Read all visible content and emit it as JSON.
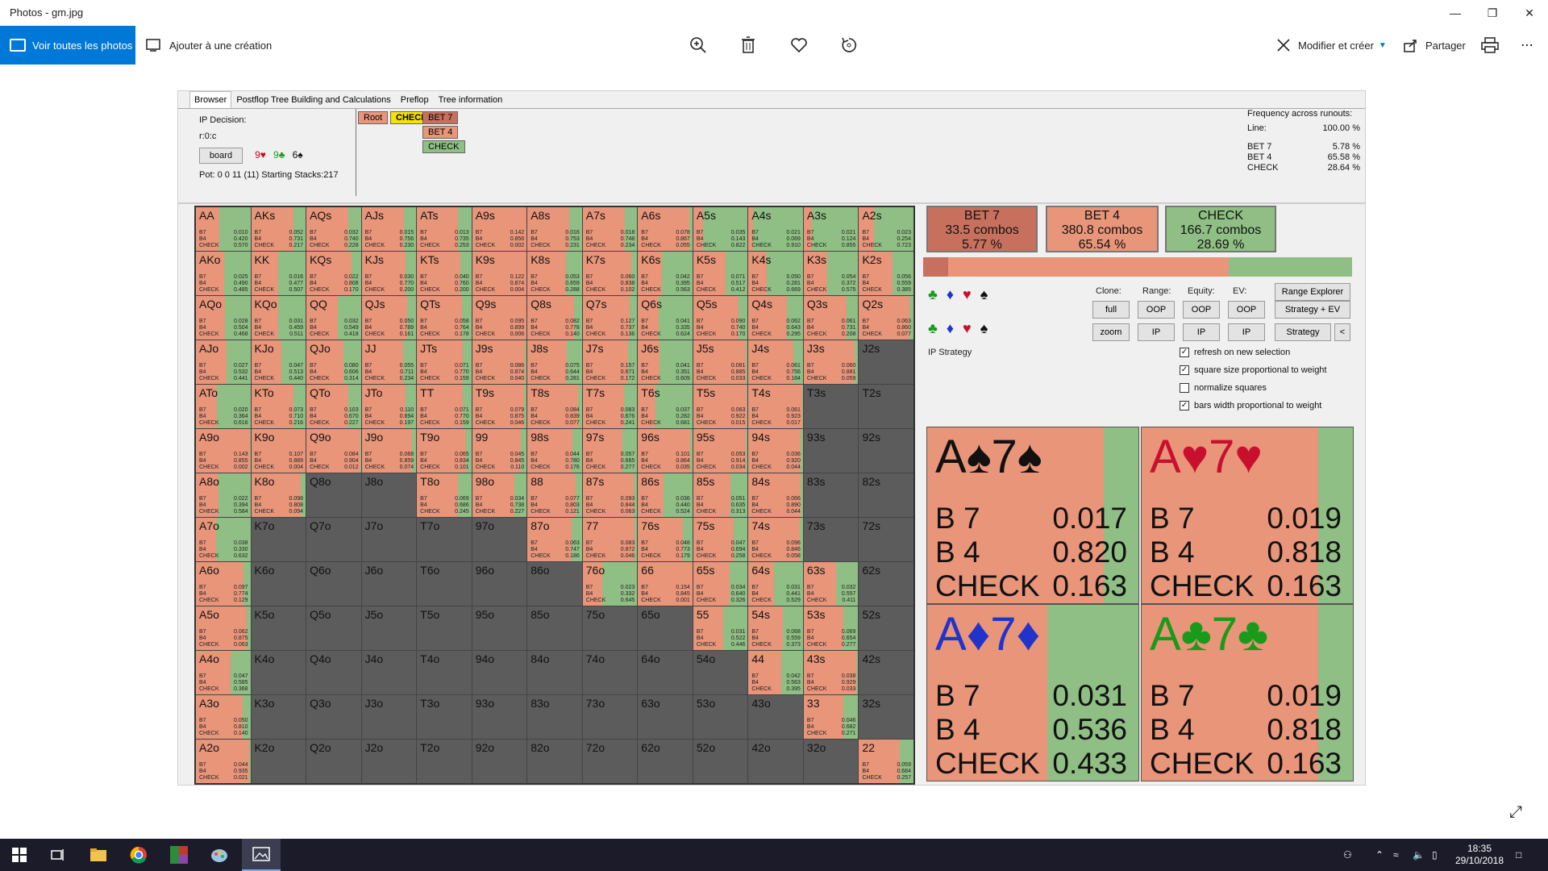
{
  "window": {
    "title": "Photos - gm.jpg"
  },
  "toolbar": {
    "see_all": "Voir toutes les photos",
    "add_creation": "Ajouter à une création",
    "edit_create": "Modifier et créer",
    "share": "Partager"
  },
  "app": {
    "tabs": [
      "Browser",
      "Postflop Tree Building and Calculations",
      "Preflop",
      "Tree information"
    ],
    "ip_decision": "IP Decision:",
    "line": "r:0:c",
    "board_button": "board",
    "board_cards": [
      {
        "text": "9♥",
        "color": "#d0021b"
      },
      {
        "text": "9♣",
        "color": "#1a9a1a"
      },
      {
        "text": "6♠",
        "color": "#111111"
      }
    ],
    "pot": "Pot: 0 0 11 (11) Starting Stacks:217",
    "tree": {
      "root": "Root",
      "check": "CHECK",
      "bet7": "BET 7",
      "bet4": "BET 4",
      "check2": "CHECK"
    },
    "freq": {
      "title": "Frequency across runouts:",
      "line_label": "Line:",
      "line_value": "100.00 %",
      "rows": [
        {
          "label": "BET 7",
          "value": "5.78 %"
        },
        {
          "label": "BET 4",
          "value": "65.58 %"
        },
        {
          "label": "CHECK",
          "value": "28.64 %"
        }
      ]
    },
    "summary": [
      {
        "l1": "BET 7",
        "l2": "33.5 combos",
        "l3": "5.77 %",
        "color": "#c8705e"
      },
      {
        "l1": "BET 4",
        "l2": "380.8 combos",
        "l3": "65.54 %",
        "color": "#e8957a"
      },
      {
        "l1": "CHECK",
        "l2": "166.7 combos",
        "l3": "28.69 %",
        "color": "#8fbf84"
      }
    ],
    "strategy_bar": {
      "bet7": 0.0577,
      "bet4": 0.6554,
      "check": 0.2869
    },
    "headers": {
      "clone": "Clone:",
      "range": "Range:",
      "equity": "Equity:",
      "ev": "EV:"
    },
    "buttons": {
      "full": "full",
      "zoom": "zoom",
      "oop": "OOP",
      "ip": "IP",
      "range_explorer": "Range Explorer",
      "strategy_ev": "Strategy + EV",
      "strategy": "Strategy",
      "lt": "<"
    },
    "ip_strategy": "IP Strategy",
    "checkboxes": [
      {
        "label": "refresh on new selection",
        "checked": "✓"
      },
      {
        "label": "square size proportional to weight",
        "checked": "✓"
      },
      {
        "label": "normalize squares",
        "checked": ""
      },
      {
        "label": "bars width proportional to weight",
        "checked": "✓"
      }
    ],
    "combos": [
      {
        "r1": "A",
        "s1": "♠",
        "r2": "7",
        "s2": "♠",
        "color": "#111111",
        "b7": "0.017",
        "b4": "0.820",
        "ck": "0.163",
        "green": 0.163
      },
      {
        "r1": "A",
        "s1": "♥",
        "r2": "7",
        "s2": "♥",
        "color": "#c8102e",
        "b7": "0.019",
        "b4": "0.818",
        "ck": "0.163",
        "green": 0.163
      },
      {
        "r1": "A",
        "s1": "♦",
        "r2": "7",
        "s2": "♦",
        "color": "#2233cc",
        "b7": "0.031",
        "b4": "0.536",
        "ck": "0.433",
        "green": 0.433
      },
      {
        "r1": "A",
        "s1": "♣",
        "r2": "7",
        "s2": "♣",
        "color": "#1a9a1a",
        "b7": "0.019",
        "b4": "0.818",
        "ck": "0.163",
        "green": 0.163
      }
    ],
    "labels": {
      "b7": "B 7",
      "b4": "B 4",
      "ck": "CHECK"
    },
    "hand_row_labels": {
      "b7": "B7",
      "b4": "B4",
      "ck": "CHECK"
    }
  },
  "grid": [
    [
      {
        "h": "AA",
        "b7": "0.010",
        "b4": "0.420",
        "ck": "0.570"
      },
      {
        "h": "AKs",
        "b7": "0.052",
        "b4": "0.731",
        "ck": "0.217"
      },
      {
        "h": "AQs",
        "b7": "0.032",
        "b4": "0.740",
        "ck": "0.228"
      },
      {
        "h": "AJs",
        "b7": "0.015",
        "b4": "0.756",
        "ck": "0.230"
      },
      {
        "h": "ATs",
        "b7": "0.013",
        "b4": "0.735",
        "ck": "0.253"
      },
      {
        "h": "A9s",
        "b7": "0.142",
        "b4": "0.856",
        "ck": "0.002"
      },
      {
        "h": "A8s",
        "b7": "0.016",
        "b4": "0.753",
        "ck": "0.231"
      },
      {
        "h": "A7s",
        "b7": "0.018",
        "b4": "0.748",
        "ck": "0.234"
      },
      {
        "h": "A6s",
        "b7": "0.078",
        "b4": "0.867",
        "ck": "0.055"
      },
      {
        "h": "A5s",
        "b7": "0.035",
        "b4": "0.143",
        "ck": "0.822"
      },
      {
        "h": "A4s",
        "b7": "0.021",
        "b4": "0.069",
        "ck": "0.910"
      },
      {
        "h": "A3s",
        "b7": "0.021",
        "b4": "0.124",
        "ck": "0.855"
      },
      {
        "h": "A2s",
        "b7": "0.023",
        "b4": "0.254",
        "ck": "0.723"
      }
    ],
    [
      {
        "h": "AKo",
        "b7": "0.025",
        "b4": "0.490",
        "ck": "0.485"
      },
      {
        "h": "KK",
        "b7": "0.016",
        "b4": "0.477",
        "ck": "0.507"
      },
      {
        "h": "KQs",
        "b7": "0.022",
        "b4": "0.808",
        "ck": "0.170"
      },
      {
        "h": "KJs",
        "b7": "0.030",
        "b4": "0.770",
        "ck": "0.200"
      },
      {
        "h": "KTs",
        "b7": "0.040",
        "b4": "0.760",
        "ck": "0.200"
      },
      {
        "h": "K9s",
        "b7": "0.122",
        "b4": "0.874",
        "ck": "0.004"
      },
      {
        "h": "K8s",
        "b7": "0.053",
        "b4": "0.659",
        "ck": "0.288"
      },
      {
        "h": "K7s",
        "b7": "0.060",
        "b4": "0.838",
        "ck": "0.102"
      },
      {
        "h": "K6s",
        "b7": "0.042",
        "b4": "0.395",
        "ck": "0.563"
      },
      {
        "h": "K5s",
        "b7": "0.071",
        "b4": "0.517",
        "ck": "0.412"
      },
      {
        "h": "K4s",
        "b7": "0.050",
        "b4": "0.281",
        "ck": "0.669"
      },
      {
        "h": "K3s",
        "b7": "0.054",
        "b4": "0.372",
        "ck": "0.575"
      },
      {
        "h": "K2s",
        "b7": "0.056",
        "b4": "0.559",
        "ck": "0.385"
      }
    ],
    [
      {
        "h": "AQo",
        "b7": "0.028",
        "b4": "0.504",
        "ck": "0.468"
      },
      {
        "h": "KQo",
        "b7": "0.031",
        "b4": "0.459",
        "ck": "0.511"
      },
      {
        "h": "QQ",
        "b7": "0.032",
        "b4": "0.549",
        "ck": "0.418"
      },
      {
        "h": "QJs",
        "b7": "0.050",
        "b4": "0.789",
        "ck": "0.161"
      },
      {
        "h": "QTs",
        "b7": "0.058",
        "b4": "0.764",
        "ck": "0.178"
      },
      {
        "h": "Q9s",
        "b7": "0.095",
        "b4": "0.899",
        "ck": "0.006"
      },
      {
        "h": "Q8s",
        "b7": "0.082",
        "b4": "0.778",
        "ck": "0.140"
      },
      {
        "h": "Q7s",
        "b7": "0.127",
        "b4": "0.737",
        "ck": "0.136"
      },
      {
        "h": "Q6s",
        "b7": "0.041",
        "b4": "0.335",
        "ck": "0.624"
      },
      {
        "h": "Q5s",
        "b7": "0.090",
        "b4": "0.740",
        "ck": "0.170"
      },
      {
        "h": "Q4s",
        "b7": "0.062",
        "b4": "0.643",
        "ck": "0.295"
      },
      {
        "h": "Q3s",
        "b7": "0.061",
        "b4": "0.731",
        "ck": "0.208"
      },
      {
        "h": "Q2s",
        "b7": "0.063",
        "b4": "0.860",
        "ck": "0.077"
      }
    ],
    [
      {
        "h": "AJo",
        "b7": "0.027",
        "b4": "0.532",
        "ck": "0.441"
      },
      {
        "h": "KJo",
        "b7": "0.047",
        "b4": "0.513",
        "ck": "0.440"
      },
      {
        "h": "QJo",
        "b7": "0.080",
        "b4": "0.606",
        "ck": "0.314"
      },
      {
        "h": "JJ",
        "b7": "0.055",
        "b4": "0.711",
        "ck": "0.234"
      },
      {
        "h": "JTs",
        "b7": "0.071",
        "b4": "0.770",
        "ck": "0.159"
      },
      {
        "h": "J9s",
        "b7": "0.086",
        "b4": "0.874",
        "ck": "0.040"
      },
      {
        "h": "J8s",
        "b7": "0.075",
        "b4": "0.644",
        "ck": "0.281"
      },
      {
        "h": "J7s",
        "b7": "0.157",
        "b4": "0.671",
        "ck": "0.172"
      },
      {
        "h": "J6s",
        "b7": "0.041",
        "b4": "0.351",
        "ck": "0.609"
      },
      {
        "h": "J5s",
        "b7": "0.081",
        "b4": "0.885",
        "ck": "0.033"
      },
      {
        "h": "J4s",
        "b7": "0.061",
        "b4": "0.756",
        "ck": "0.184"
      },
      {
        "h": "J3s",
        "b7": "0.060",
        "b4": "0.881",
        "ck": "0.059"
      },
      {
        "h": "J2s",
        "dead": true
      }
    ],
    [
      {
        "h": "ATo",
        "b7": "0.020",
        "b4": "0.364",
        "ck": "0.616"
      },
      {
        "h": "KTo",
        "b7": "0.073",
        "b4": "0.710",
        "ck": "0.216"
      },
      {
        "h": "QTo",
        "b7": "0.103",
        "b4": "0.670",
        "ck": "0.227"
      },
      {
        "h": "JTo",
        "b7": "0.110",
        "b4": "0.694",
        "ck": "0.197"
      },
      {
        "h": "TT",
        "b7": "0.071",
        "b4": "0.770",
        "ck": "0.159"
      },
      {
        "h": "T9s",
        "b7": "0.079",
        "b4": "0.875",
        "ck": "0.046"
      },
      {
        "h": "T8s",
        "b7": "0.084",
        "b4": "0.839",
        "ck": "0.077"
      },
      {
        "h": "T7s",
        "b7": "0.083",
        "b4": "0.676",
        "ck": "0.241"
      },
      {
        "h": "T6s",
        "b7": "0.037",
        "b4": "0.282",
        "ck": "0.681"
      },
      {
        "h": "T5s",
        "b7": "0.063",
        "b4": "0.922",
        "ck": "0.015"
      },
      {
        "h": "T4s",
        "b7": "0.061",
        "b4": "0.923",
        "ck": "0.017"
      },
      {
        "h": "T3s",
        "dead": true
      },
      {
        "h": "T2s",
        "dead": true
      }
    ],
    [
      {
        "h": "A9o",
        "b7": "0.143",
        "b4": "0.855",
        "ck": "0.002"
      },
      {
        "h": "K9o",
        "b7": "0.107",
        "b4": "0.889",
        "ck": "0.004"
      },
      {
        "h": "Q9o",
        "b7": "0.084",
        "b4": "0.904",
        "ck": "0.012"
      },
      {
        "h": "J9o",
        "b7": "0.068",
        "b4": "0.859",
        "ck": "0.074"
      },
      {
        "h": "T9o",
        "b7": "0.065",
        "b4": "0.834",
        "ck": "0.101"
      },
      {
        "h": "99",
        "b7": "0.045",
        "b4": "0.845",
        "ck": "0.110"
      },
      {
        "h": "98s",
        "b7": "0.044",
        "b4": "0.780",
        "ck": "0.176"
      },
      {
        "h": "97s",
        "b7": "0.057",
        "b4": "0.665",
        "ck": "0.277"
      },
      {
        "h": "96s",
        "b7": "0.101",
        "b4": "0.864",
        "ck": "0.035"
      },
      {
        "h": "95s",
        "b7": "0.053",
        "b4": "0.914",
        "ck": "0.034"
      },
      {
        "h": "94s",
        "b7": "0.036",
        "b4": "0.920",
        "ck": "0.044"
      },
      {
        "h": "93s",
        "dead": true
      },
      {
        "h": "92s",
        "dead": true
      }
    ],
    [
      {
        "h": "A8o",
        "b7": "0.022",
        "b4": "0.394",
        "ck": "0.584"
      },
      {
        "h": "K8o",
        "b7": "0.098",
        "b4": "0.808",
        "ck": "0.094"
      },
      {
        "h": "Q8o",
        "dead": true
      },
      {
        "h": "J8o",
        "dead": true
      },
      {
        "h": "T8o",
        "b7": "0.069",
        "b4": "0.686",
        "ck": "0.245"
      },
      {
        "h": "98o",
        "b7": "0.034",
        "b4": "0.738",
        "ck": "0.227"
      },
      {
        "h": "88",
        "b7": "0.077",
        "b4": "0.803",
        "ck": "0.121"
      },
      {
        "h": "87s",
        "b7": "0.093",
        "b4": "0.844",
        "ck": "0.063"
      },
      {
        "h": "86s",
        "b7": "0.036",
        "b4": "0.440",
        "ck": "0.524"
      },
      {
        "h": "85s",
        "b7": "0.051",
        "b4": "0.635",
        "ck": "0.313"
      },
      {
        "h": "84s",
        "b7": "0.066",
        "b4": "0.890",
        "ck": "0.044"
      },
      {
        "h": "83s",
        "dead": true
      },
      {
        "h": "82s",
        "dead": true
      }
    ],
    [
      {
        "h": "A7o",
        "b7": "0.038",
        "b4": "0.330",
        "ck": "0.632"
      },
      {
        "h": "K7o",
        "dead": true
      },
      {
        "h": "Q7o",
        "dead": true
      },
      {
        "h": "J7o",
        "dead": true
      },
      {
        "h": "T7o",
        "dead": true
      },
      {
        "h": "97o",
        "dead": true
      },
      {
        "h": "87o",
        "b7": "0.063",
        "b4": "0.747",
        "ck": "0.186"
      },
      {
        "h": "77",
        "b7": "0.083",
        "b4": "0.872",
        "ck": "0.046"
      },
      {
        "h": "76s",
        "b7": "0.048",
        "b4": "0.773",
        "ck": "0.179"
      },
      {
        "h": "75s",
        "b7": "0.047",
        "b4": "0.694",
        "ck": "0.258"
      },
      {
        "h": "74s",
        "b7": "0.096",
        "b4": "0.846",
        "ck": "0.058"
      },
      {
        "h": "73s",
        "dead": true
      },
      {
        "h": "72s",
        "dead": true
      }
    ],
    [
      {
        "h": "A6o",
        "b7": "0.097",
        "b4": "0.774",
        "ck": "0.129"
      },
      {
        "h": "K6o",
        "dead": true
      },
      {
        "h": "Q6o",
        "dead": true
      },
      {
        "h": "J6o",
        "dead": true
      },
      {
        "h": "T6o",
        "dead": true
      },
      {
        "h": "96o",
        "dead": true
      },
      {
        "h": "86o",
        "dead": true
      },
      {
        "h": "76o",
        "b7": "0.023",
        "b4": "0.332",
        "ck": "0.645"
      },
      {
        "h": "66",
        "b7": "0.154",
        "b4": "0.845",
        "ck": "0.001"
      },
      {
        "h": "65s",
        "b7": "0.034",
        "b4": "0.640",
        "ck": "0.326"
      },
      {
        "h": "64s",
        "b7": "0.031",
        "b4": "0.441",
        "ck": "0.529"
      },
      {
        "h": "63s",
        "b7": "0.032",
        "b4": "0.557",
        "ck": "0.411"
      },
      {
        "h": "62s",
        "dead": true
      }
    ],
    [
      {
        "h": "A5o",
        "b7": "0.062",
        "b4": "0.875",
        "ck": "0.063"
      },
      {
        "h": "K5o",
        "dead": true
      },
      {
        "h": "Q5o",
        "dead": true
      },
      {
        "h": "J5o",
        "dead": true
      },
      {
        "h": "T5o",
        "dead": true
      },
      {
        "h": "95o",
        "dead": true
      },
      {
        "h": "85o",
        "dead": true
      },
      {
        "h": "75o",
        "dead": true
      },
      {
        "h": "65o",
        "dead": true
      },
      {
        "h": "55",
        "b7": "0.031",
        "b4": "0.522",
        "ck": "0.446"
      },
      {
        "h": "54s",
        "b7": "0.068",
        "b4": "0.559",
        "ck": "0.373"
      },
      {
        "h": "53s",
        "b7": "0.069",
        "b4": "0.654",
        "ck": "0.277"
      },
      {
        "h": "52s",
        "dead": true
      }
    ],
    [
      {
        "h": "A4o",
        "b7": "0.047",
        "b4": "0.585",
        "ck": "0.368"
      },
      {
        "h": "K4o",
        "dead": true
      },
      {
        "h": "Q4o",
        "dead": true
      },
      {
        "h": "J4o",
        "dead": true
      },
      {
        "h": "T4o",
        "dead": true
      },
      {
        "h": "94o",
        "dead": true
      },
      {
        "h": "84o",
        "dead": true
      },
      {
        "h": "74o",
        "dead": true
      },
      {
        "h": "64o",
        "dead": true
      },
      {
        "h": "54o",
        "dead": true
      },
      {
        "h": "44",
        "b7": "0.042",
        "b4": "0.563",
        "ck": "0.395"
      },
      {
        "h": "43s",
        "b7": "0.038",
        "b4": "0.929",
        "ck": "0.033"
      },
      {
        "h": "42s",
        "dead": true
      }
    ],
    [
      {
        "h": "A3o",
        "b7": "0.050",
        "b4": "0.810",
        "ck": "0.140"
      },
      {
        "h": "K3o",
        "dead": true
      },
      {
        "h": "Q3o",
        "dead": true
      },
      {
        "h": "J3o",
        "dead": true
      },
      {
        "h": "T3o",
        "dead": true
      },
      {
        "h": "93o",
        "dead": true
      },
      {
        "h": "83o",
        "dead": true
      },
      {
        "h": "73o",
        "dead": true
      },
      {
        "h": "63o",
        "dead": true
      },
      {
        "h": "53o",
        "dead": true
      },
      {
        "h": "43o",
        "dead": true
      },
      {
        "h": "33",
        "b7": "0.046",
        "b4": "0.682",
        "ck": "0.271"
      },
      {
        "h": "32s",
        "dead": true
      }
    ],
    [
      {
        "h": "A2o",
        "b7": "0.044",
        "b4": "0.935",
        "ck": "0.021"
      },
      {
        "h": "K2o",
        "dead": true
      },
      {
        "h": "Q2o",
        "dead": true
      },
      {
        "h": "J2o",
        "dead": true
      },
      {
        "h": "T2o",
        "dead": true
      },
      {
        "h": "92o",
        "dead": true
      },
      {
        "h": "82o",
        "dead": true
      },
      {
        "h": "72o",
        "dead": true
      },
      {
        "h": "62o",
        "dead": true
      },
      {
        "h": "52o",
        "dead": true
      },
      {
        "h": "42o",
        "dead": true
      },
      {
        "h": "32o",
        "dead": true
      },
      {
        "h": "22",
        "b7": "0.059",
        "b4": "0.684",
        "ck": "0.257"
      }
    ]
  ],
  "taskbar": {
    "time": "18:35",
    "date": "29/10/2018"
  }
}
